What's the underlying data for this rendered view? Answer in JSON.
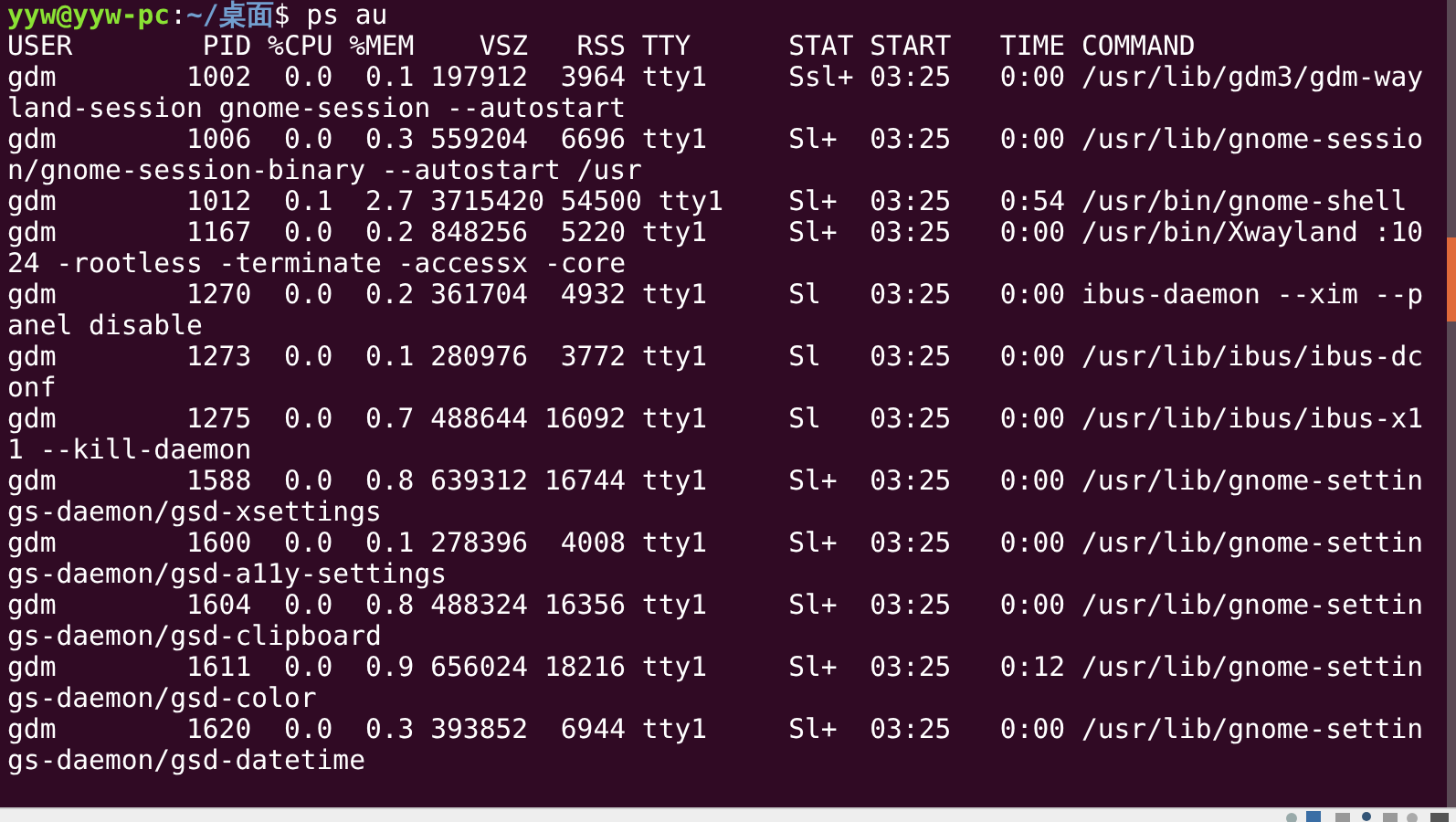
{
  "terminal": {
    "prompt": {
      "user_host": "yyw@yyw-pc",
      "separator": ":",
      "path": "~/桌面",
      "command": "$ ps au"
    },
    "lines": [
      "USER        PID %CPU %MEM    VSZ   RSS TTY      STAT START   TIME COMMAND",
      "gdm        1002  0.0  0.1 197912  3964 tty1     Ssl+ 03:25   0:00 /usr/lib/gdm3/gdm-way",
      "land-session gnome-session --autostart",
      "gdm        1006  0.0  0.3 559204  6696 tty1     Sl+  03:25   0:00 /usr/lib/gnome-sessio",
      "n/gnome-session-binary --autostart /usr",
      "gdm        1012  0.1  2.7 3715420 54500 tty1    Sl+  03:25   0:54 /usr/bin/gnome-shell",
      "gdm        1167  0.0  0.2 848256  5220 tty1     Sl+  03:25   0:00 /usr/bin/Xwayland :10",
      "24 -rootless -terminate -accessx -core",
      "gdm        1270  0.0  0.2 361704  4932 tty1     Sl   03:25   0:00 ibus-daemon --xim --p",
      "anel disable",
      "gdm        1273  0.0  0.1 280976  3772 tty1     Sl   03:25   0:00 /usr/lib/ibus/ibus-dc",
      "onf",
      "gdm        1275  0.0  0.7 488644 16092 tty1     Sl   03:25   0:00 /usr/lib/ibus/ibus-x1",
      "1 --kill-daemon",
      "gdm        1588  0.0  0.8 639312 16744 tty1     Sl+  03:25   0:00 /usr/lib/gnome-settin",
      "gs-daemon/gsd-xsettings",
      "gdm        1600  0.0  0.1 278396  4008 tty1     Sl+  03:25   0:00 /usr/lib/gnome-settin",
      "gs-daemon/gsd-a11y-settings",
      "gdm        1604  0.0  0.8 488324 16356 tty1     Sl+  03:25   0:00 /usr/lib/gnome-settin",
      "gs-daemon/gsd-clipboard",
      "gdm        1611  0.0  0.9 656024 18216 tty1     Sl+  03:25   0:12 /usr/lib/gnome-settin",
      "gs-daemon/gsd-color",
      "gdm        1620  0.0  0.3 393852  6944 tty1     Sl+  03:25   0:00 /usr/lib/gnome-settin",
      "gs-daemon/gsd-datetime"
    ]
  }
}
